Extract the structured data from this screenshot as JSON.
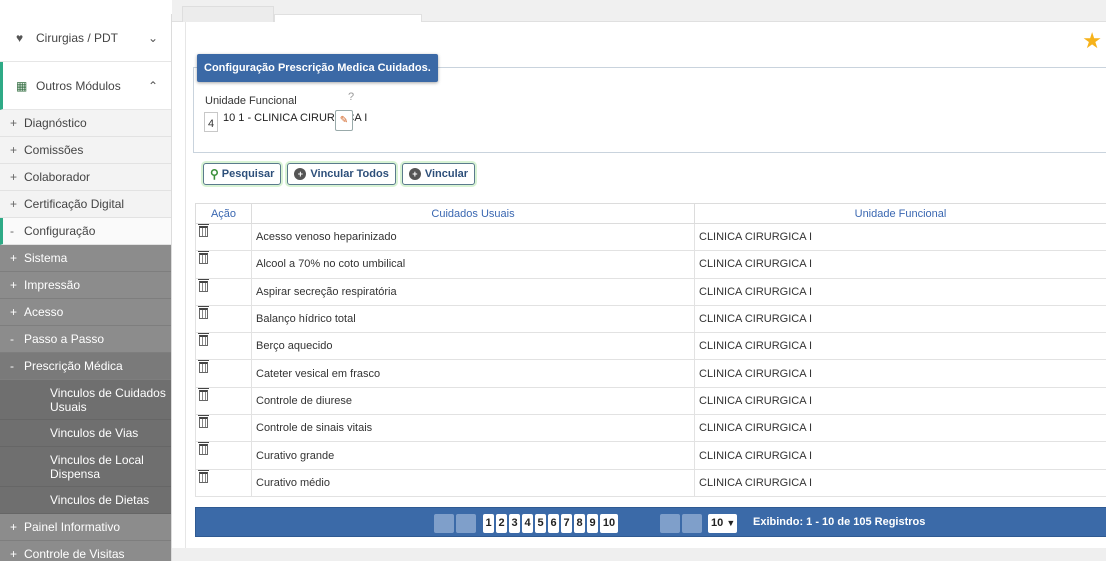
{
  "sidebar": {
    "cirurgias": {
      "label": "Cirurgias / PDT",
      "icon": "heart-icon",
      "chevron": "chevron-down"
    },
    "outros": {
      "label": "Outros Módulos",
      "icon": "grid-icon",
      "chevron": "chevron-up"
    },
    "items": [
      {
        "prefix": "+",
        "label": "Diagnóstico"
      },
      {
        "prefix": "+",
        "label": "Comissões"
      },
      {
        "prefix": "+",
        "label": "Colaborador"
      },
      {
        "prefix": "+",
        "label": "Certificação Digital"
      },
      {
        "prefix": "-",
        "label": "Configuração"
      }
    ],
    "config_items": [
      {
        "prefix": "+",
        "label": "Sistema"
      },
      {
        "prefix": "+",
        "label": "Impressão"
      },
      {
        "prefix": "+",
        "label": "Acesso"
      },
      {
        "prefix": "-",
        "label": "Passo a Passo"
      },
      {
        "prefix": "-",
        "label": "Prescrição Médica"
      }
    ],
    "prescricao_subitems": [
      {
        "label": "Vinculos de Cuidados Usuais"
      },
      {
        "label": "Vinculos de Vias"
      },
      {
        "label": "Vinculos de Local Dispensa"
      },
      {
        "label": "Vinculos de Dietas"
      }
    ],
    "tail_items": [
      {
        "prefix": "+",
        "label": "Painel Informativo"
      },
      {
        "prefix": "+",
        "label": "Controle de Visitas"
      }
    ]
  },
  "panel": {
    "title": "Configuração Prescrição Medica Cuidados.",
    "unidade_label": "Unidade Funcional",
    "help": "?",
    "unidade_code": "4",
    "unidade_value": "10 1 - CLINICA CIRURGICA I"
  },
  "actions": {
    "pesquisar": "Pesquisar",
    "vincular_todos": "Vincular Todos",
    "vincular": "Vincular"
  },
  "table": {
    "headers": [
      "Ação",
      "Cuidados Usuais",
      "Unidade Funcional"
    ],
    "rows": [
      {
        "cuidado": "Acesso venoso heparinizado",
        "unidade": "CLINICA CIRURGICA I"
      },
      {
        "cuidado": "Alcool a 70% no coto umbilical",
        "unidade": "CLINICA CIRURGICA I"
      },
      {
        "cuidado": "Aspirar secreção respiratória",
        "unidade": "CLINICA CIRURGICA I"
      },
      {
        "cuidado": "Balanço hídrico total",
        "unidade": "CLINICA CIRURGICA I"
      },
      {
        "cuidado": "Berço aquecido",
        "unidade": "CLINICA CIRURGICA I"
      },
      {
        "cuidado": "Cateter vesical em frasco",
        "unidade": "CLINICA CIRURGICA I"
      },
      {
        "cuidado": "Controle de diurese",
        "unidade": "CLINICA CIRURGICA I"
      },
      {
        "cuidado": "Controle de sinais vitais",
        "unidade": "CLINICA CIRURGICA I"
      },
      {
        "cuidado": "Curativo grande",
        "unidade": "CLINICA CIRURGICA I"
      },
      {
        "cuidado": "Curativo médio",
        "unidade": "CLINICA CIRURGICA I"
      }
    ]
  },
  "pager": {
    "pages": [
      "1",
      "2",
      "3",
      "4",
      "5",
      "6",
      "7",
      "8",
      "9",
      "10"
    ],
    "page_size": "10",
    "info": "Exibindo: 1 - 10 de 105 Registros"
  },
  "colors": {
    "accent": "#2eaa86",
    "header_blue": "#3b69a6",
    "star": "#f6b21a"
  }
}
